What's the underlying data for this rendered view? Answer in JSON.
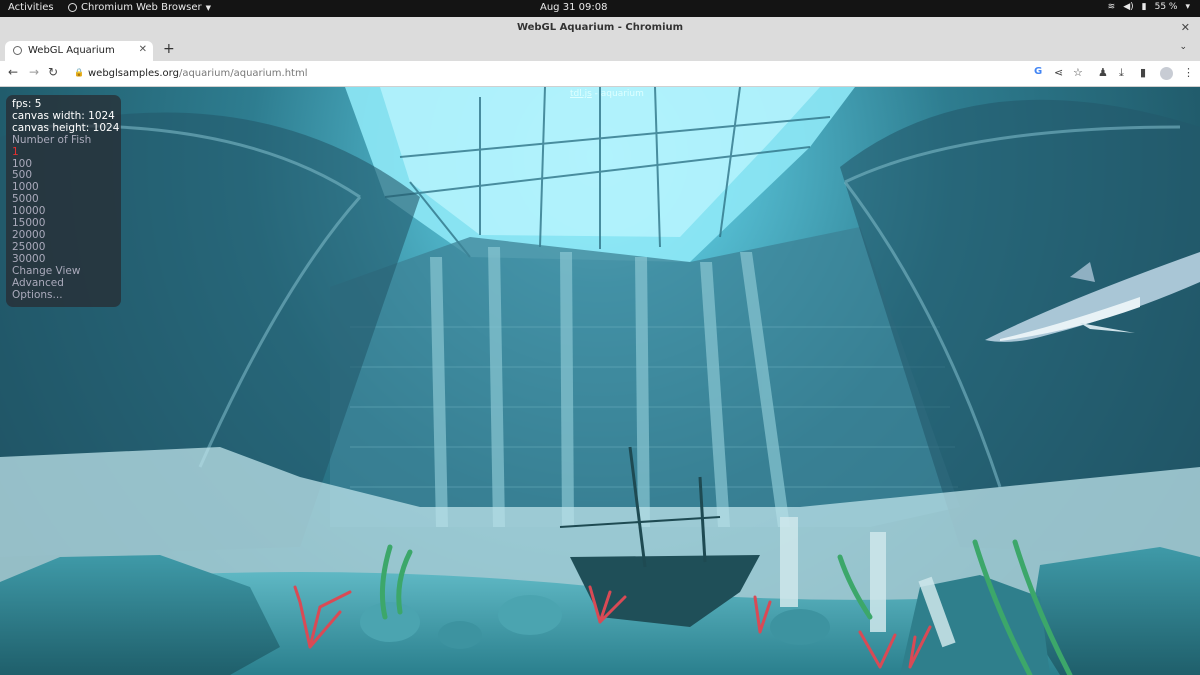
{
  "topbar": {
    "activities": "Activities",
    "app_name": "Chromium Web Browser",
    "clock": "Aug 31  09:08",
    "battery": "55 %"
  },
  "window": {
    "title": "WebGL Aquarium - Chromium"
  },
  "tabs": [
    {
      "label": "WebGL Aquarium",
      "active": true
    }
  ],
  "toolbar": {
    "url_host": "webglsamples.org",
    "url_path": "/aquarium/aquarium.html"
  },
  "aquarium": {
    "credit_link": "tdl.js",
    "credit_text": " - aquarium",
    "fps": "fps: 5",
    "canvas_width": "canvas width: 1024",
    "canvas_height": "canvas height: 1024",
    "fish_header": "Number of Fish",
    "fish_options": [
      "1",
      "100",
      "500",
      "1000",
      "5000",
      "10000",
      "15000",
      "20000",
      "25000",
      "30000"
    ],
    "selected_fish": "1",
    "menu": [
      "Change View",
      "Advanced",
      "Options..."
    ]
  },
  "colors": {
    "water": "#2e6f82",
    "dome_light": "#7fe6f5",
    "selected": "#e23030"
  }
}
